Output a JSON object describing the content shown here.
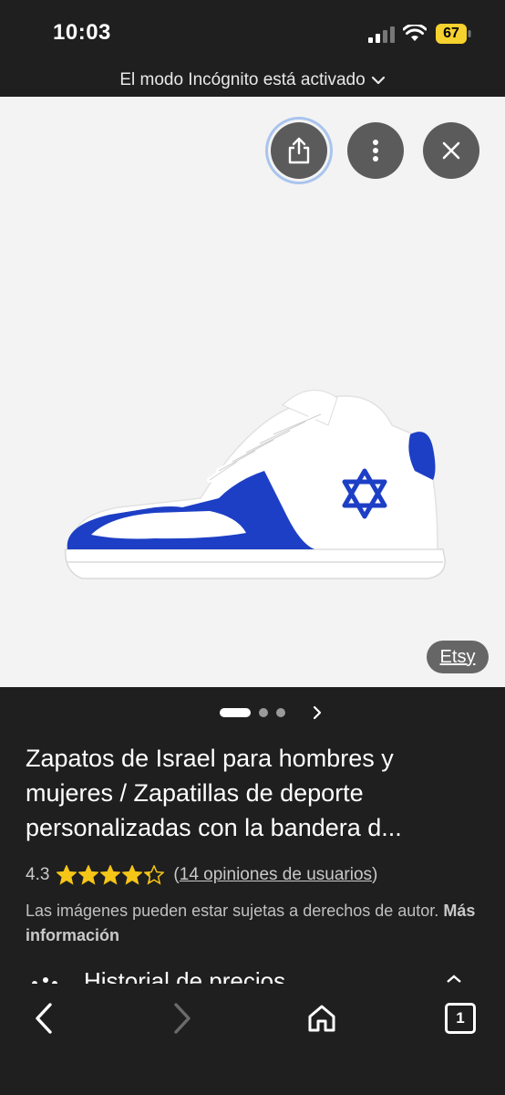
{
  "status_bar": {
    "time": "10:03",
    "battery_level": "67",
    "icons": [
      "signal-icon",
      "wifi-icon",
      "battery-icon"
    ]
  },
  "incognito": {
    "label": "El modo Incógnito está activado"
  },
  "viewer": {
    "actions": [
      "share-icon",
      "more-vert-icon",
      "close-icon"
    ],
    "source": "Etsy",
    "pager": {
      "total": 3,
      "active": 1
    }
  },
  "product": {
    "title": "Zapatos de Israel para hombres y mujeres / Zapatillas de deporte personalizadas con la bandera d...",
    "rating": "4.3",
    "rating_value": 4.3,
    "rating_max": 5,
    "reviews_open": "(",
    "reviews_link": "14 opiniones de usuarios",
    "reviews_close": ")",
    "copyright_text": "Las imágenes pueden estar sujetas a derechos de autor.",
    "more_info": "Más información",
    "next_section": "Historial de precios"
  },
  "toolbar": {
    "tab_count": "1",
    "icons": [
      "back-arrow-icon",
      "forward-arrow-icon",
      "home-icon",
      "tabs-icon"
    ]
  },
  "colors": {
    "background": "#1f1f1f",
    "image_background": "#f3f3f3",
    "star": "#f5c518",
    "battery": "#f7d12e",
    "shoe_blue": "#1d3fc6"
  }
}
